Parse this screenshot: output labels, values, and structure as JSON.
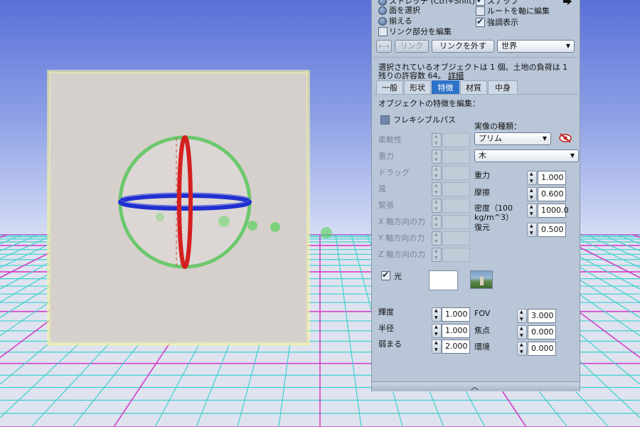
{
  "top_options": {
    "partial_label": "ストレッチ (Ctrl+Shift)",
    "select_face": "面を選択",
    "align": "揃える",
    "edit_linked": "リンク部分を編集",
    "snap": "スナップ",
    "edit_axis_root": "ルートを軸に編集",
    "highlight": "強調表示"
  },
  "link_row": {
    "link_button": "リンク",
    "unlink_button": "リンクを外す",
    "ruler_select": "世界"
  },
  "info": {
    "line1": "選択されているオブジェクトは 1 個、土地の負荷は 1",
    "line2_prefix": "残りの許容数 64。",
    "details_link": "詳細"
  },
  "tabs": [
    "一般",
    "形状",
    "特徴",
    "材質",
    "中身"
  ],
  "features": {
    "section_title": "オブジェクトの特徴を編集：",
    "flexible_label": "フレキシブルパス",
    "flex_fields": [
      "柔軟性",
      "重力",
      "ドラッグ",
      "風",
      "緊張",
      "X 軸方向の力",
      "Y 軸方向の力",
      "Z 軸方向の力"
    ],
    "physics_type_label": "実像の種類：",
    "physics_type_value": "プリム",
    "material_value": "木",
    "physics": [
      {
        "label": "重力",
        "value": "1.000"
      },
      {
        "label": "摩擦",
        "value": "0.600"
      },
      {
        "label": "密度（100 kg/m^3）",
        "value": "1000.0"
      },
      {
        "label": "復元",
        "value": "0.500"
      }
    ],
    "light_label": "光",
    "light": [
      {
        "label": "輝度",
        "value": "1.000"
      },
      {
        "label": "半径",
        "value": "1.000"
      },
      {
        "label": "弱まる",
        "value": "2.000"
      }
    ],
    "projector": [
      {
        "label": "FOV",
        "value": "3.000"
      },
      {
        "label": "焦点",
        "value": "0.000"
      },
      {
        "label": "環境",
        "value": "0.000"
      }
    ]
  },
  "icons": {
    "collapse": "chevron-up-icon",
    "eye": "eye-crossed-icon",
    "arrow": "arrow-right-icon"
  },
  "colors": {
    "active_tab": "#2f73c8",
    "panel_bg": "#b9c6d8",
    "axis_x": "#d42020",
    "axis_y": "#6cc86c",
    "axis_z": "#2030d0"
  }
}
